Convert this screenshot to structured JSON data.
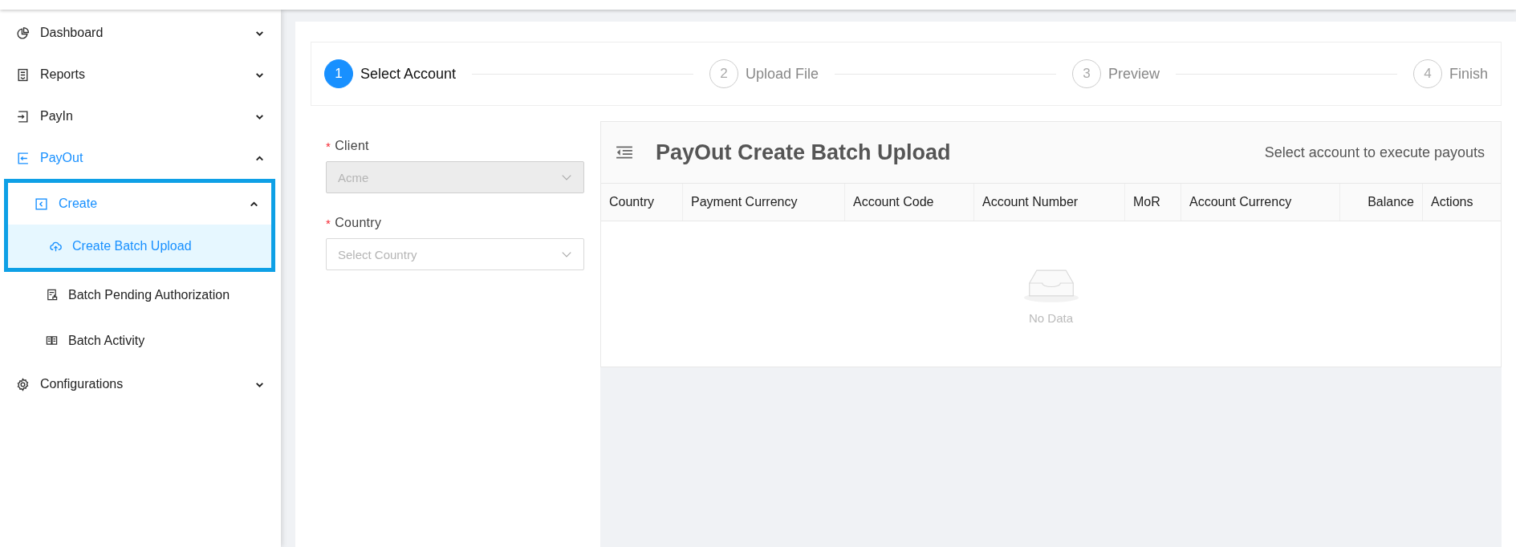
{
  "sidebar": {
    "items": [
      {
        "label": "Dashboard",
        "expanded": false
      },
      {
        "label": "Reports",
        "expanded": false
      },
      {
        "label": "PayIn",
        "expanded": false
      },
      {
        "label": "PayOut",
        "expanded": true,
        "children": [
          {
            "label": "Create",
            "expanded": true,
            "children": [
              {
                "label": "Create Batch Upload",
                "selected": true
              },
              {
                "label": "Batch Pending Authorization",
                "selected": false
              },
              {
                "label": "Batch Activity",
                "selected": false
              }
            ]
          }
        ]
      },
      {
        "label": "Configurations",
        "expanded": false
      }
    ]
  },
  "steps": [
    {
      "number": "1",
      "label": "Select Account",
      "selected": true
    },
    {
      "number": "2",
      "label": "Upload File",
      "selected": false
    },
    {
      "number": "3",
      "label": "Preview",
      "selected": false
    },
    {
      "number": "4",
      "label": "Finish",
      "selected": false
    }
  ],
  "form": {
    "fields": [
      {
        "label": "Client",
        "required_mark": "*",
        "value": "Acme",
        "disabled": true
      },
      {
        "label": "Country",
        "required_mark": "*",
        "placeholder": "Select Country",
        "disabled": false
      }
    ]
  },
  "table": {
    "title": "PayOut Create Batch Upload",
    "subtitle": "Select account to execute payouts",
    "columns": [
      "Country",
      "Payment Currency",
      "Account Code",
      "Account Number",
      "MoR",
      "Account Currency",
      "Balance",
      "Actions"
    ],
    "empty_text": "No Data"
  }
}
